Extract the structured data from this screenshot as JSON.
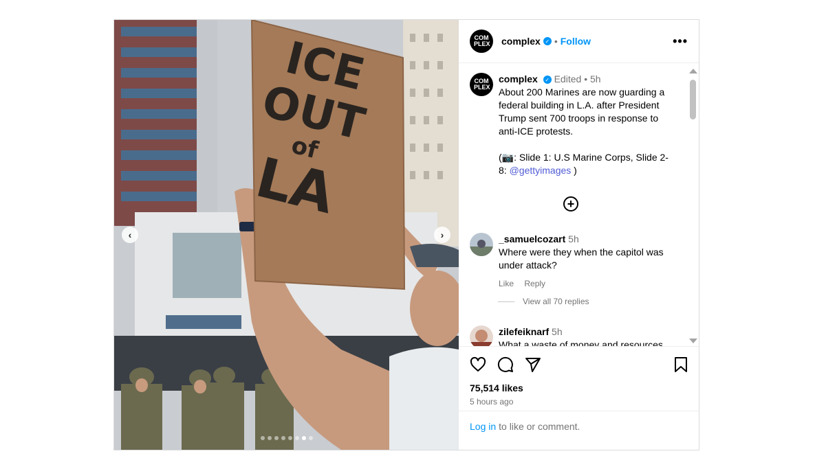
{
  "post": {
    "username": "complex",
    "avatar_text": "COM PLEX",
    "follow_label": "Follow",
    "more_label": "•••",
    "separator": "•"
  },
  "caption": {
    "username": "complex",
    "edited": "Edited",
    "time": "5h",
    "text": "About 200 Marines are now guarding a federal building in L.A. after President Trump sent 700 troops in response to anti-ICE protests.",
    "credit_prefix": "(📷: Slide 1: U.S Marine Corps, Slide 2-8: ",
    "credit_link": "@gettyimages",
    "credit_suffix": " )"
  },
  "media": {
    "sign_text": [
      "ICE",
      "OUT",
      "of",
      "LA"
    ],
    "prev_label": "‹",
    "next_label": "›",
    "slide_count": 8,
    "active_slide": 7
  },
  "comments": [
    {
      "username": "_samuelcozart",
      "time": "5h",
      "text": "Where were they when the capitol was under attack?",
      "like_label": "Like",
      "reply_label": "Reply",
      "view_replies": "View all 70 replies"
    },
    {
      "username": "zilefeiknarf",
      "time": "5h",
      "text": "What a waste of money and resources"
    }
  ],
  "footer": {
    "likes": "75,514 likes",
    "time_ago": "5 hours ago",
    "login_link": "Log in",
    "login_text": "to like or comment."
  },
  "colors": {
    "accent": "#0095f6",
    "secondary_text": "#737373"
  }
}
